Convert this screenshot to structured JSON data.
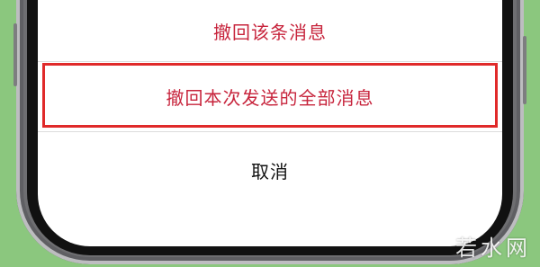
{
  "sheet": {
    "retract_message": "撤回该条消息",
    "retract_all_messages": "撤回本次发送的全部消息",
    "cancel": "取消"
  },
  "watermark": "若水网",
  "colors": {
    "background": "#8bc77e",
    "action_text": "#c7243c",
    "highlight_border": "#e02a2a",
    "cancel_text": "#111111"
  }
}
